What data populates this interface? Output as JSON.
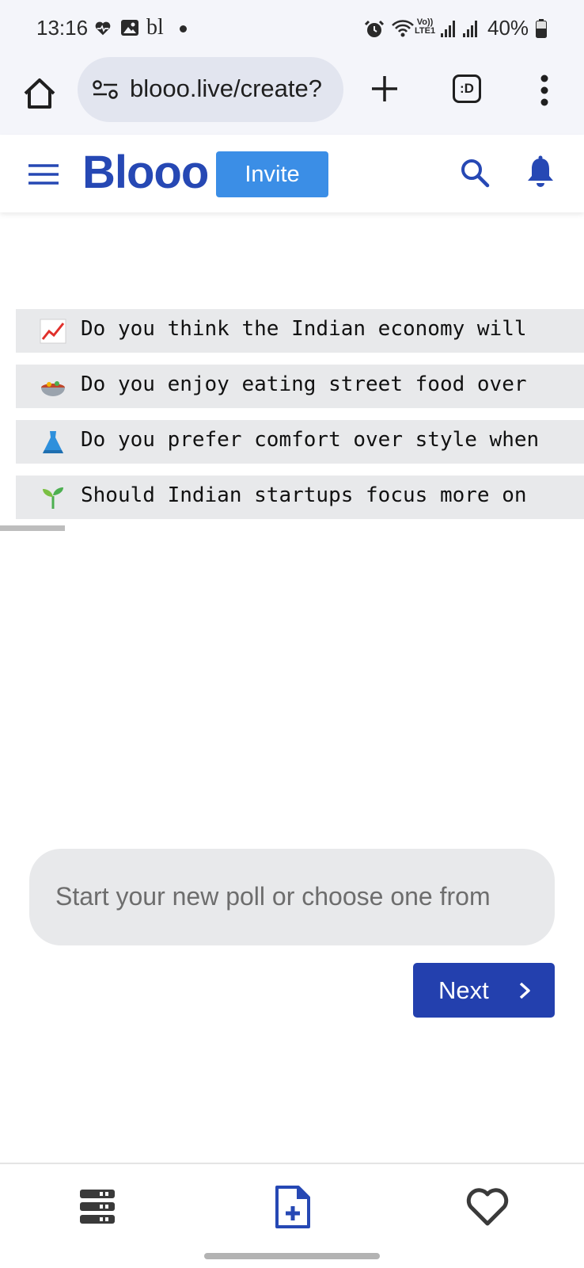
{
  "status_bar": {
    "time": "13:16",
    "carrier_text": "bl",
    "lte_top": "Vo))",
    "lte_bottom": "LTE1",
    "battery": "40%"
  },
  "browser": {
    "url": "blooo.live/create?",
    "tabs_label": ":D"
  },
  "header": {
    "logo": "Blooo",
    "invite_label": "Invite"
  },
  "suggestions": [
    {
      "icon": "chart-increasing-icon",
      "text": "Do you think the Indian economy will"
    },
    {
      "icon": "food-bowl-icon",
      "text": "Do you enjoy eating street food over"
    },
    {
      "icon": "dress-icon",
      "text": "Do you prefer comfort over style when"
    },
    {
      "icon": "seedling-icon",
      "text": "Should Indian startups focus more on"
    }
  ],
  "composer": {
    "placeholder": "Start your new poll or choose one from",
    "next_label": "Next"
  },
  "colors": {
    "brand": "#2648b4",
    "invite": "#3b8ee6",
    "next": "#2340ae"
  }
}
